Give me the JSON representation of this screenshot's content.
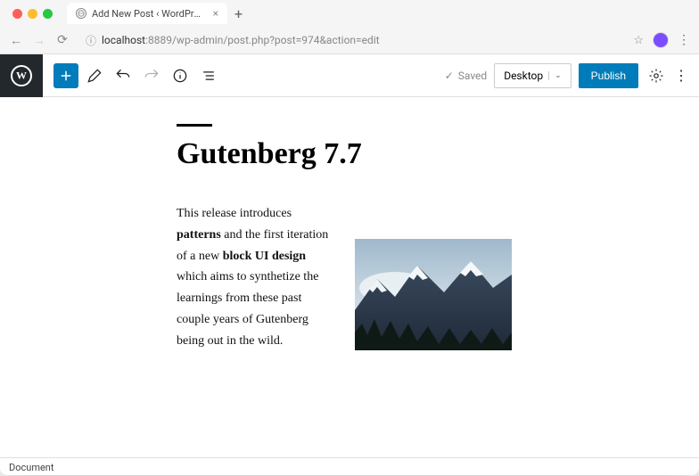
{
  "browser": {
    "tab_title": "Add New Post ‹ WordPress De",
    "url_host": "localhost",
    "url_port": ":8889",
    "url_path": "/wp-admin/post.php?post=974&action=edit"
  },
  "toolbar": {
    "saved_label": "Saved",
    "preview_label": "Desktop",
    "publish_label": "Publish"
  },
  "post": {
    "title": "Gutenberg 7.7",
    "body_html": "This release introduces <b>patterns</b> and the first iteration of a new <b>block UI design</b> which aims to synthetize the learnings from these past couple years of Gutenberg being out in the wild."
  },
  "footer": {
    "breadcrumb": "Document"
  },
  "colors": {
    "wp_admin_dark": "#23282d",
    "wp_primary": "#007cba"
  }
}
